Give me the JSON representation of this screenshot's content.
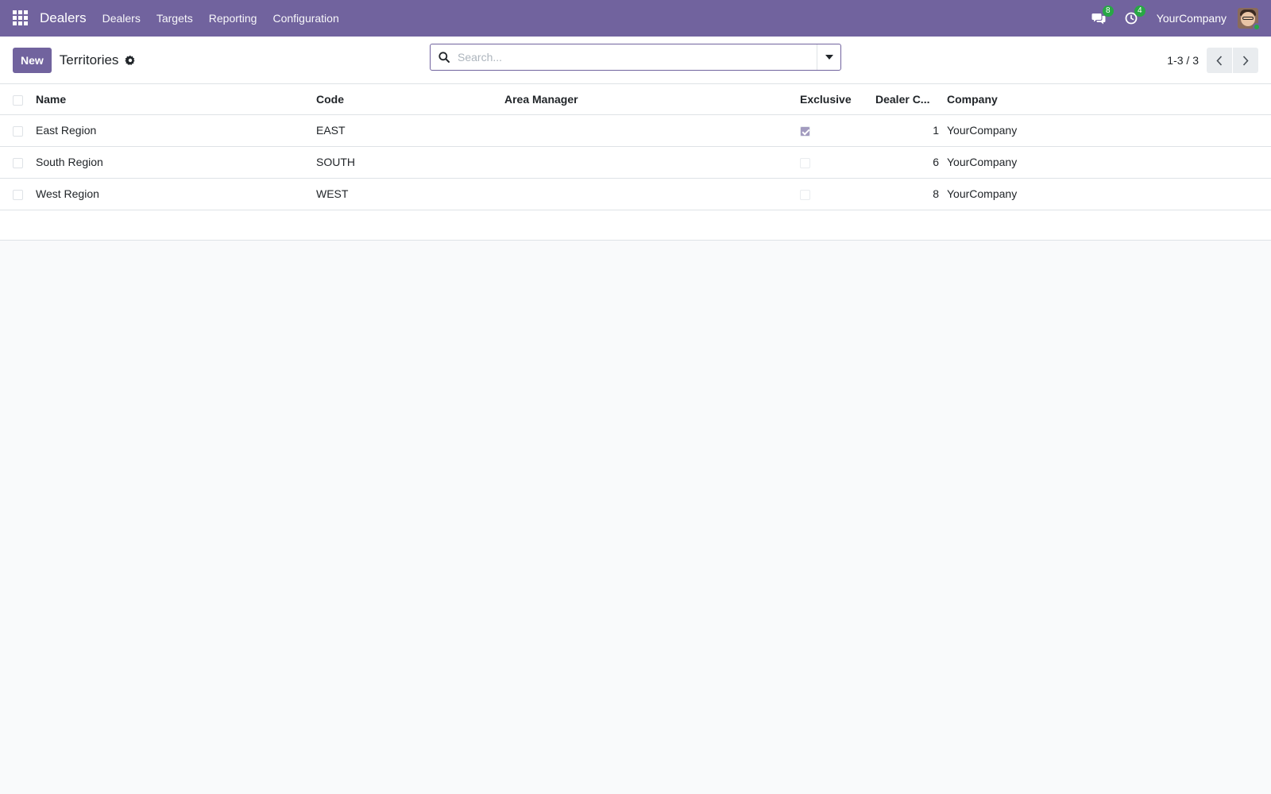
{
  "navbar": {
    "brand": "Dealers",
    "menu": [
      "Dealers",
      "Targets",
      "Reporting",
      "Configuration"
    ],
    "messages_count": "8",
    "activities_count": "4",
    "company": "YourCompany",
    "accent_color": "#71639e"
  },
  "control_panel": {
    "new_label": "New",
    "title": "Territories",
    "search_placeholder": "Search...",
    "pager": "1-3 / 3"
  },
  "table": {
    "columns": {
      "name": "Name",
      "code": "Code",
      "area_manager": "Area Manager",
      "exclusive": "Exclusive",
      "dealer_count": "Dealer C...",
      "company": "Company"
    },
    "rows": [
      {
        "name": "East Region",
        "code": "EAST",
        "area_manager": "",
        "exclusive": true,
        "dealer_count": "1",
        "company": "YourCompany"
      },
      {
        "name": "South Region",
        "code": "SOUTH",
        "area_manager": "",
        "exclusive": false,
        "dealer_count": "6",
        "company": "YourCompany"
      },
      {
        "name": "West Region",
        "code": "WEST",
        "area_manager": "",
        "exclusive": false,
        "dealer_count": "8",
        "company": "YourCompany"
      }
    ]
  }
}
